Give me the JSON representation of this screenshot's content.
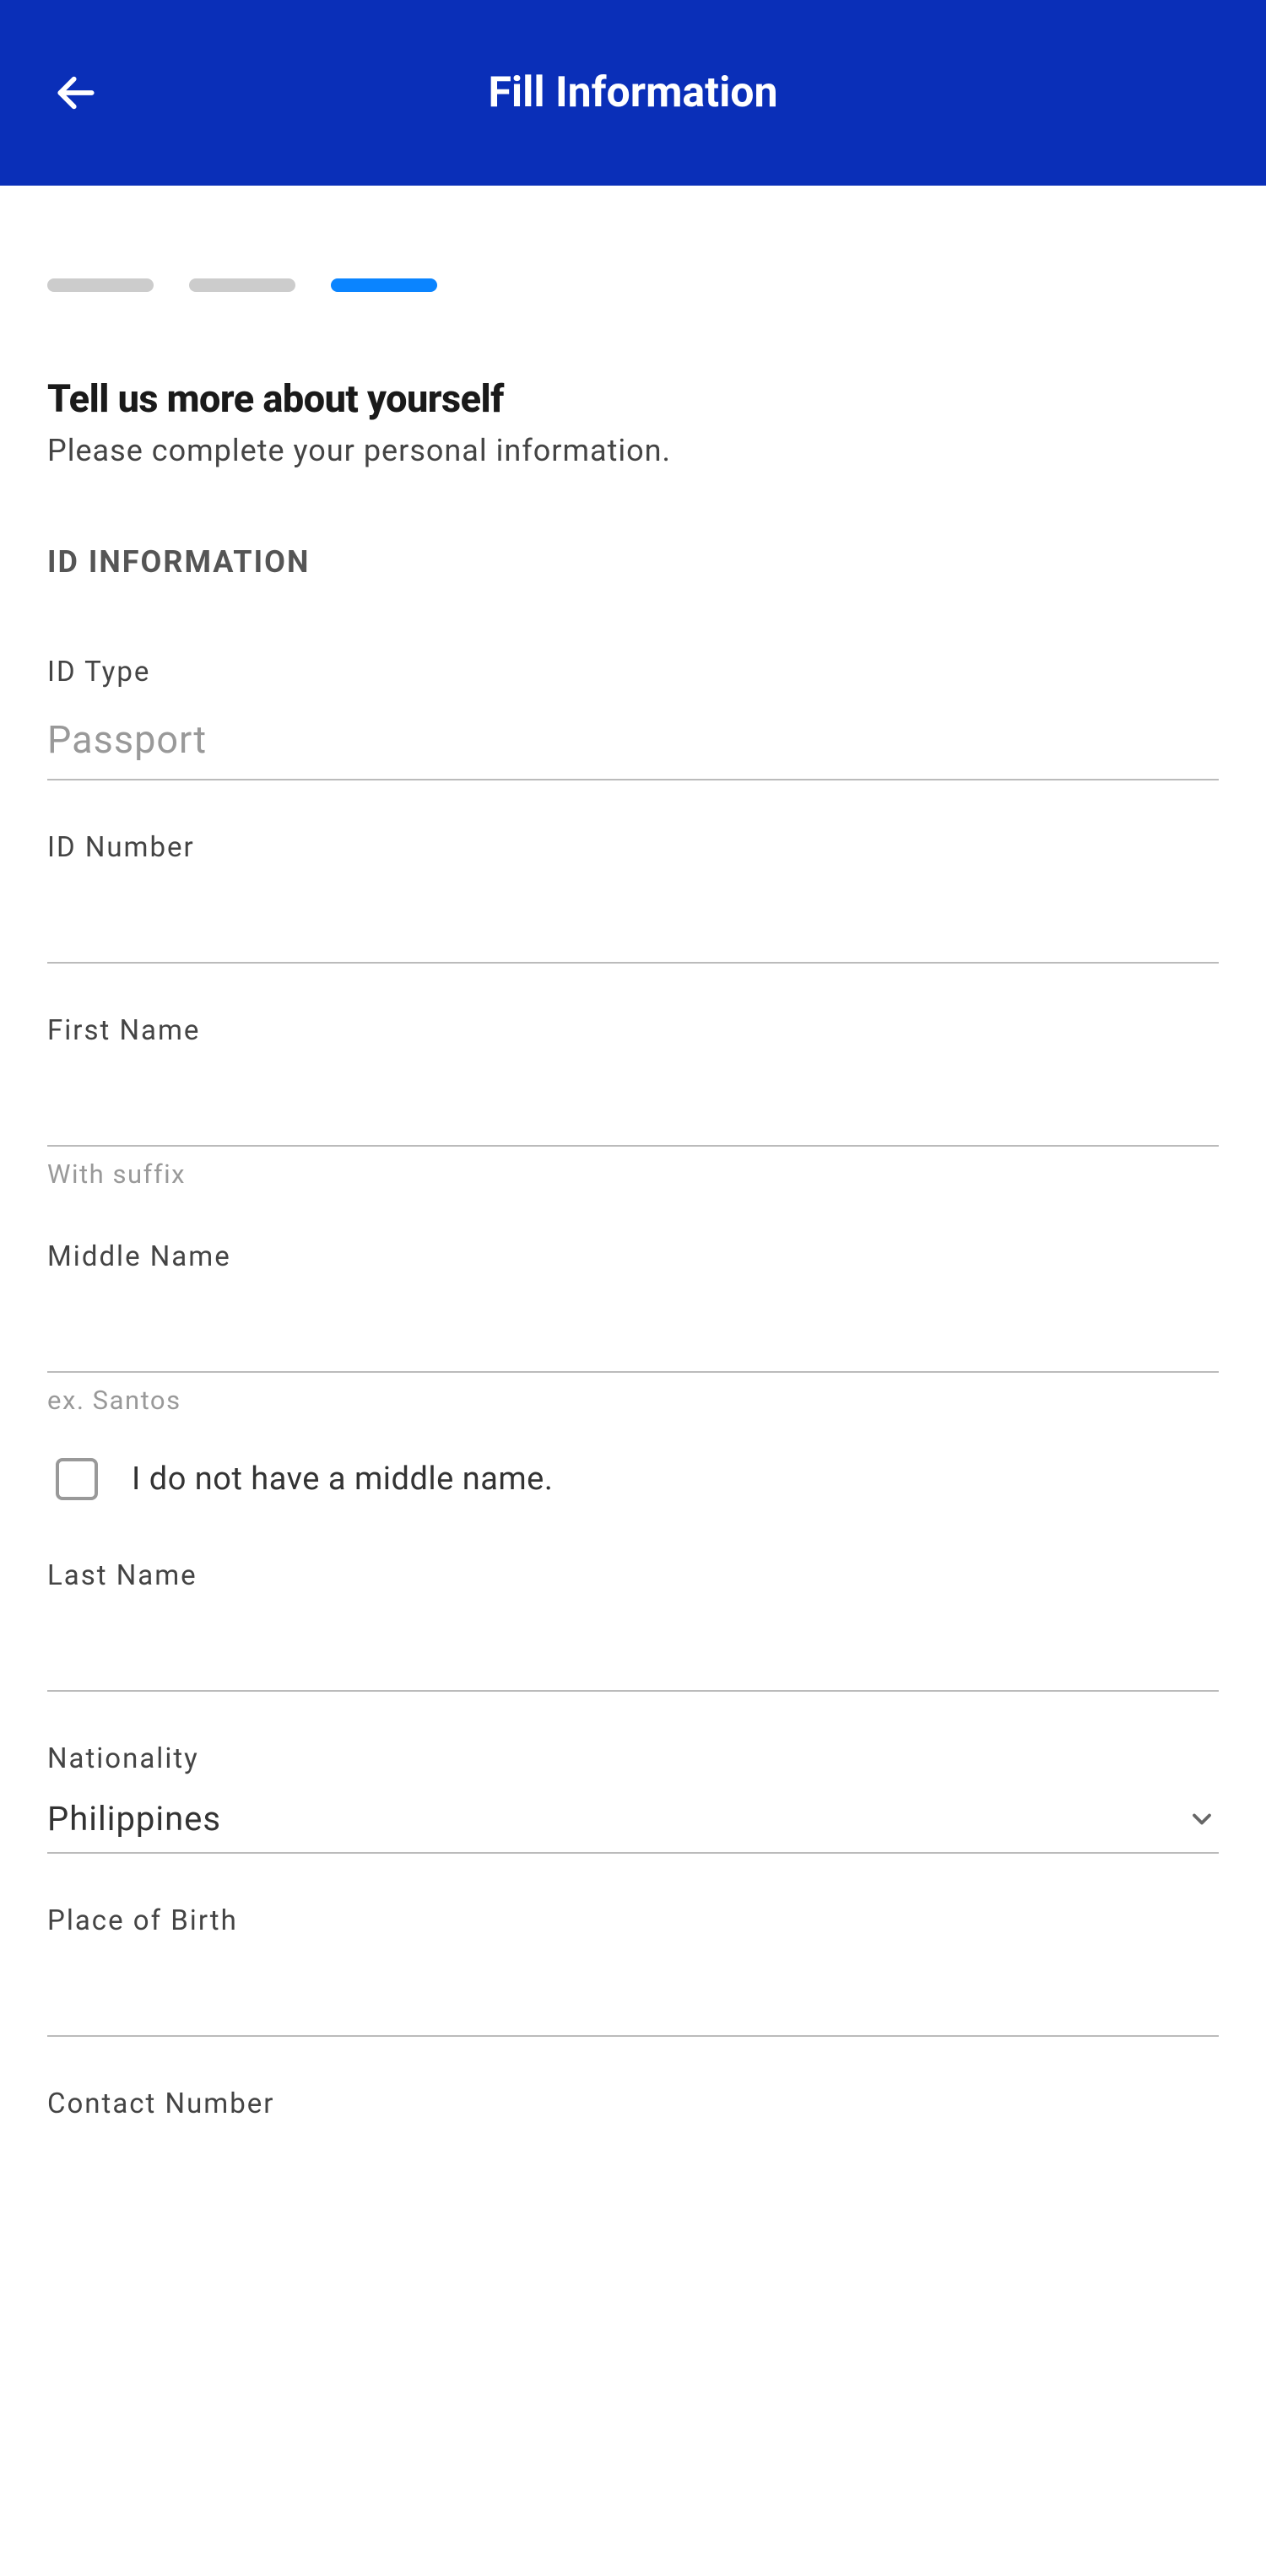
{
  "header": {
    "title": "Fill Information"
  },
  "progress": {
    "segments": 3,
    "active_index": 2
  },
  "section": {
    "title": "Tell us more about yourself",
    "subtitle": "Please complete your personal information."
  },
  "group": {
    "heading": "ID INFORMATION"
  },
  "fields": {
    "id_type": {
      "label": "ID Type",
      "value": "Passport"
    },
    "id_number": {
      "label": "ID Number",
      "value": ""
    },
    "first_name": {
      "label": "First Name",
      "value": "",
      "helper": "With suffix"
    },
    "middle_name": {
      "label": "Middle Name",
      "value": "",
      "helper": "ex. Santos",
      "checkbox_label": "I do not have a middle name."
    },
    "last_name": {
      "label": "Last Name",
      "value": ""
    },
    "nationality": {
      "label": "Nationality",
      "value": "Philippines"
    },
    "place_of_birth": {
      "label": "Place of Birth",
      "value": ""
    },
    "contact_number": {
      "label": "Contact Number",
      "value": ""
    }
  }
}
